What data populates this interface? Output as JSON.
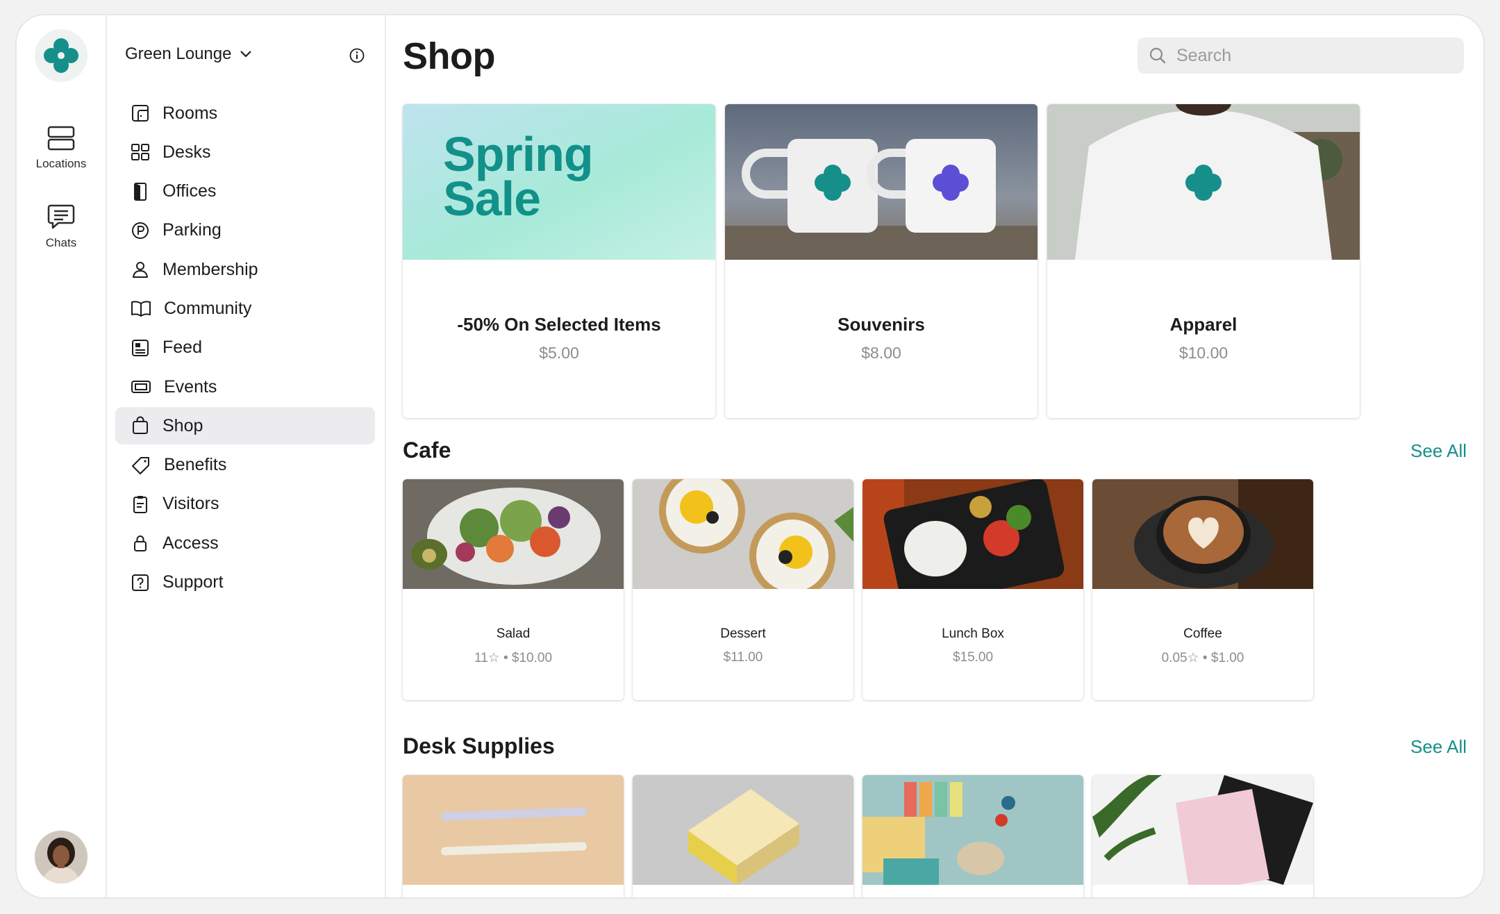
{
  "rail": {
    "items": [
      {
        "label": "Locations",
        "icon": "locations-icon"
      },
      {
        "label": "Chats",
        "icon": "chat-icon"
      }
    ]
  },
  "sidebar": {
    "location_name": "Green Lounge",
    "items": [
      {
        "label": "Rooms",
        "icon": "door-icon"
      },
      {
        "label": "Desks",
        "icon": "grid-icon"
      },
      {
        "label": "Offices",
        "icon": "office-door-icon"
      },
      {
        "label": "Parking",
        "icon": "parking-icon"
      },
      {
        "label": "Membership",
        "icon": "person-icon"
      },
      {
        "label": "Community",
        "icon": "book-icon"
      },
      {
        "label": "Feed",
        "icon": "news-icon"
      },
      {
        "label": "Events",
        "icon": "ticket-icon"
      },
      {
        "label": "Shop",
        "icon": "bag-icon",
        "active": true
      },
      {
        "label": "Benefits",
        "icon": "tag-icon"
      },
      {
        "label": "Visitors",
        "icon": "clipboard-icon"
      },
      {
        "label": "Access",
        "icon": "lock-icon"
      },
      {
        "label": "Support",
        "icon": "help-icon"
      }
    ]
  },
  "main": {
    "title": "Shop",
    "search_placeholder": "Search",
    "featured": [
      {
        "title": "-50% On Selected Items",
        "price": "$5.00",
        "banner_text_1": "Spring",
        "banner_text_2": "Sale"
      },
      {
        "title": "Souvenirs",
        "price": "$8.00"
      },
      {
        "title": "Apparel",
        "price": "$10.00"
      }
    ],
    "cafe": {
      "title": "Cafe",
      "see_all": "See All",
      "items": [
        {
          "title": "Salad",
          "price": "11☆ • $10.00"
        },
        {
          "title": "Dessert",
          "price": "$11.00"
        },
        {
          "title": "Lunch Box",
          "price": "$15.00"
        },
        {
          "title": "Coffee",
          "price": "0.05☆ • $1.00"
        }
      ]
    },
    "desk_supplies": {
      "title": "Desk Supplies",
      "see_all": "See All"
    }
  },
  "colors": {
    "brand": "#158f8a",
    "active_bg": "#ececee",
    "muted_text": "#8c8c91"
  }
}
